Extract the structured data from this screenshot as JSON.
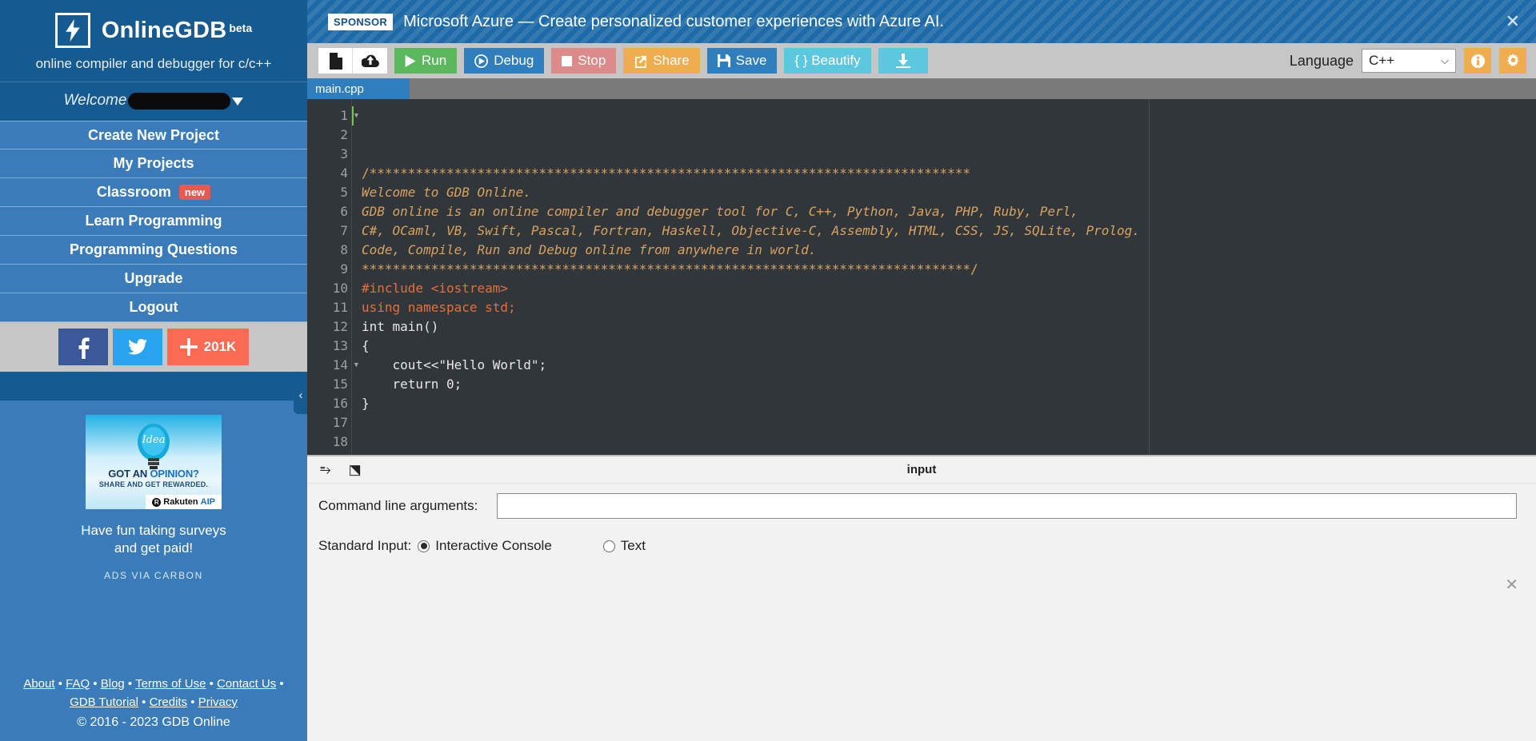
{
  "sidebar": {
    "brand": {
      "name": "OnlineGDB",
      "beta": "beta",
      "tagline": "online compiler and debugger for c/c++"
    },
    "welcome": {
      "label": "Welcome"
    },
    "nav": [
      {
        "label": "Create New Project",
        "badge": ""
      },
      {
        "label": "My Projects",
        "badge": ""
      },
      {
        "label": "Classroom",
        "badge": "new"
      },
      {
        "label": "Learn Programming",
        "badge": ""
      },
      {
        "label": "Programming Questions",
        "badge": ""
      },
      {
        "label": "Upgrade",
        "badge": ""
      },
      {
        "label": "Logout",
        "badge": ""
      }
    ],
    "social": {
      "facebook": "facebook-icon",
      "twitter": "twitter-icon",
      "plus_count": "201K"
    },
    "ad": {
      "headline_a": "GOT AN ",
      "headline_b": "OPINION?",
      "subline": "SHARE AND GET REWARDED.",
      "brand_r": "R",
      "brand_name": "Rakuten",
      "brand_suffix": "AIP",
      "caption_line1": "Have fun taking surveys",
      "caption_line2": "and get paid!",
      "via": "ADS VIA CARBON"
    },
    "footer": {
      "links_row1": [
        "About",
        "FAQ",
        "Blog",
        "Terms of Use",
        "Contact Us"
      ],
      "links_row2": [
        "GDB Tutorial",
        "Credits",
        "Privacy"
      ],
      "copyright": "© 2016 - 2023 GDB Online",
      "sep": " • ",
      "trailing_sep": " •"
    },
    "collapse": "‹"
  },
  "sponsor": {
    "tag": "SPONSOR",
    "text": "Microsoft Azure — Create personalized customer experiences with Azure AI.",
    "close": "✕"
  },
  "toolbar": {
    "new_file_icon": "new-file-icon",
    "upload_icon": "upload-icon",
    "run": "Run",
    "debug": "Debug",
    "stop": "Stop",
    "share": "Share",
    "save": "Save",
    "beautify": "{ } Beautify",
    "download_icon": "download-icon",
    "language_label": "Language",
    "language_value": "C++",
    "chevron": "⌵",
    "info_icon": "info-icon",
    "settings_icon": "gear-icon"
  },
  "editor": {
    "tab_name": "main.cpp",
    "line_numbers": [
      "1",
      "2",
      "3",
      "4",
      "5",
      "6",
      "7",
      "8",
      "9",
      "10",
      "11",
      "12",
      "13",
      "14",
      "15",
      "16",
      "17",
      "18"
    ],
    "fold_lines": [
      1,
      14
    ],
    "code_lines": [
      "/******************************************************************************",
      "",
      "Welcome to GDB Online.",
      "GDB online is an online compiler and debugger tool for C, C++, Python, Java, PHP, Ruby, Perl,",
      "C#, OCaml, VB, Swift, Pascal, Fortran, Haskell, Objective-C, Assembly, HTML, CSS, JS, SQLite, Prolog.",
      "Code, Compile, Run and Debug online from anywhere in world.",
      "",
      "*******************************************************************************/",
      "#include <iostream>",
      "",
      "using namespace std;",
      "",
      "int main()",
      "{",
      "    cout<<\"Hello World\";",
      "",
      "    return 0;",
      "}"
    ]
  },
  "io": {
    "collapse_icon": "chevron-down-icon",
    "expand_icon": "expand-icon",
    "title": "input",
    "cmdline_label": "Command line arguments:",
    "cmdline_value": "",
    "cmdline_placeholder": "",
    "stdin_label": "Standard Input:",
    "option_interactive": "Interactive Console",
    "option_text": "Text",
    "selected_option": "Interactive Console",
    "close": "✕"
  },
  "colors": {
    "sidebar_blue": "#3a7cb9",
    "sidebar_dark": "#155a91",
    "accent_orange": "#f0ad4e",
    "run_green": "#5cb85c",
    "editor_bg": "#31363a"
  }
}
